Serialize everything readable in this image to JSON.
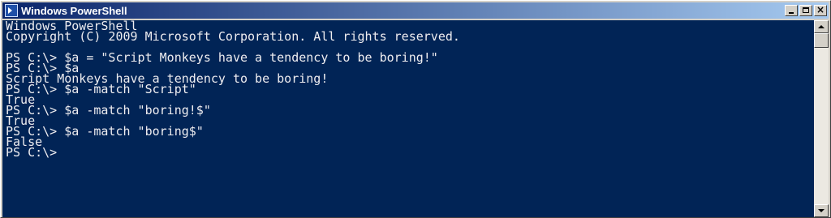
{
  "window": {
    "title": "Windows PowerShell",
    "title_icon": "powershell-icon",
    "buttons": {
      "minimize": "minimize-icon",
      "maximize": "maximize-icon",
      "close_label": "×"
    }
  },
  "colors": {
    "console_bg": "#012456",
    "console_fg": "#eeedf0",
    "titlebar_start": "#0a246a",
    "titlebar_end": "#a6caf0"
  },
  "console": {
    "lines": [
      "Windows PowerShell",
      "Copyright (C) 2009 Microsoft Corporation. All rights reserved.",
      "",
      "PS C:\\> $a = \"Script Monkeys have a tendency to be boring!\"",
      "PS C:\\> $a",
      "Script Monkeys have a tendency to be boring!",
      "PS C:\\> $a -match \"Script\"",
      "True",
      "PS C:\\> $a -match \"boring!$\"",
      "True",
      "PS C:\\> $a -match \"boring$\"",
      "False",
      "PS C:\\>"
    ]
  }
}
